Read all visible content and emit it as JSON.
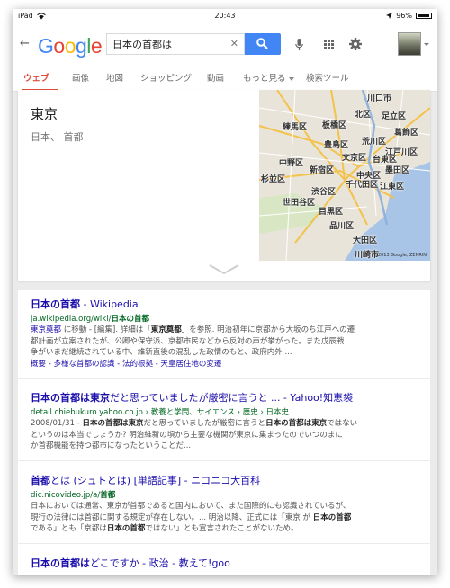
{
  "status": {
    "device": "iPad",
    "time": "20:43",
    "battery": "96%"
  },
  "header": {
    "logo": "Google",
    "query": "日本の首都は"
  },
  "tabs": [
    {
      "label": "ウェブ",
      "active": true
    },
    {
      "label": "画像"
    },
    {
      "label": "地図"
    },
    {
      "label": "ショッピング"
    },
    {
      "label": "動画"
    },
    {
      "label": "もっと見る"
    },
    {
      "label": "検索ツール"
    }
  ],
  "knowledge": {
    "title": "東京",
    "subtitle": "日本、 首都",
    "map_labels": [
      "川口市",
      "北区",
      "足立区",
      "練馬区",
      "板橋区",
      "葛飾区",
      "豊島区",
      "荒川区",
      "文京区",
      "台東区",
      "新宿区",
      "中野区",
      "墨田区",
      "江戸川区",
      "杉並区",
      "千代田区",
      "中央区",
      "江東区",
      "渋谷区",
      "世田谷区",
      "目黒区",
      "品川区",
      "大田区",
      "川崎市"
    ],
    "map_copyright": "©2013 Google, ZENRIN"
  },
  "results": [
    {
      "title_a": "日本の首都",
      "title_b": " - Wikipedia",
      "url_a": "ja.wikipedia.org/wiki/",
      "url_b": "日本の首都",
      "redirect_a": "東京奠都",
      "redirect_b": " に移動 - [編集]. 詳細は「",
      "redirect_c": "東京奠都",
      "redirect_d": "」を参照. 明治初年に京都から大坂のち江戸への遷",
      "snippet_2": "都計画が立案されたが、公卿や保守派、京都市民などから反対の声が挙がった。また戊辰戦",
      "snippet_3": "争がいまだ継続されている中、維新直後の混乱した政情のもと、政府内外 ...",
      "sublinks": "概要 - 多様な首都の認識 - 法的根拠 - 天皇居住地の変遷"
    },
    {
      "title_a": "日本の首都は東京",
      "title_b": "だと思っていましたが厳密に言うと ... - Yahoo!知恵袋",
      "url_a": "detail.chiebukuro.yahoo.co.jp",
      "url_b": " › 教養と学問、サイエンス › 歴史 › 日本史",
      "date": "2008/01/31 - ",
      "s1a": "日本の首都は東京",
      "s1b": "だと思っていましたが厳密に言うと",
      "s1c": "日本の首都は東京",
      "s1d": "ではない",
      "snippet_2": "というのは本当でしょうか? 明治維新の頃から主要な機関が東京に集まったのでいつのまに",
      "snippet_3": "か首都機能を持つ都市になったということだ..."
    },
    {
      "title_a": "首都",
      "title_b": "とは (シュトとは) [単語記事] - ニコニコ大百科",
      "url_a": "dic.nicovideo.jp/a/",
      "url_b": "首都",
      "snippet_1": "日本においては通常、東京が首都であると国内において、また国際的にも認識されているが、",
      "s2a": "現行の法律には首都に関する規定が存在しない。... 明治以降、正式には「東京 が ",
      "s2b": "日本の首都",
      "s3a": "である」とも「京都は",
      "s3b": "日本の首都",
      "s3c": "ではない」とも宣言されたことがないため。"
    },
    {
      "title_a": "日本の首都は",
      "title_b": "どこですか - 政治 - 教えて!goo"
    }
  ]
}
